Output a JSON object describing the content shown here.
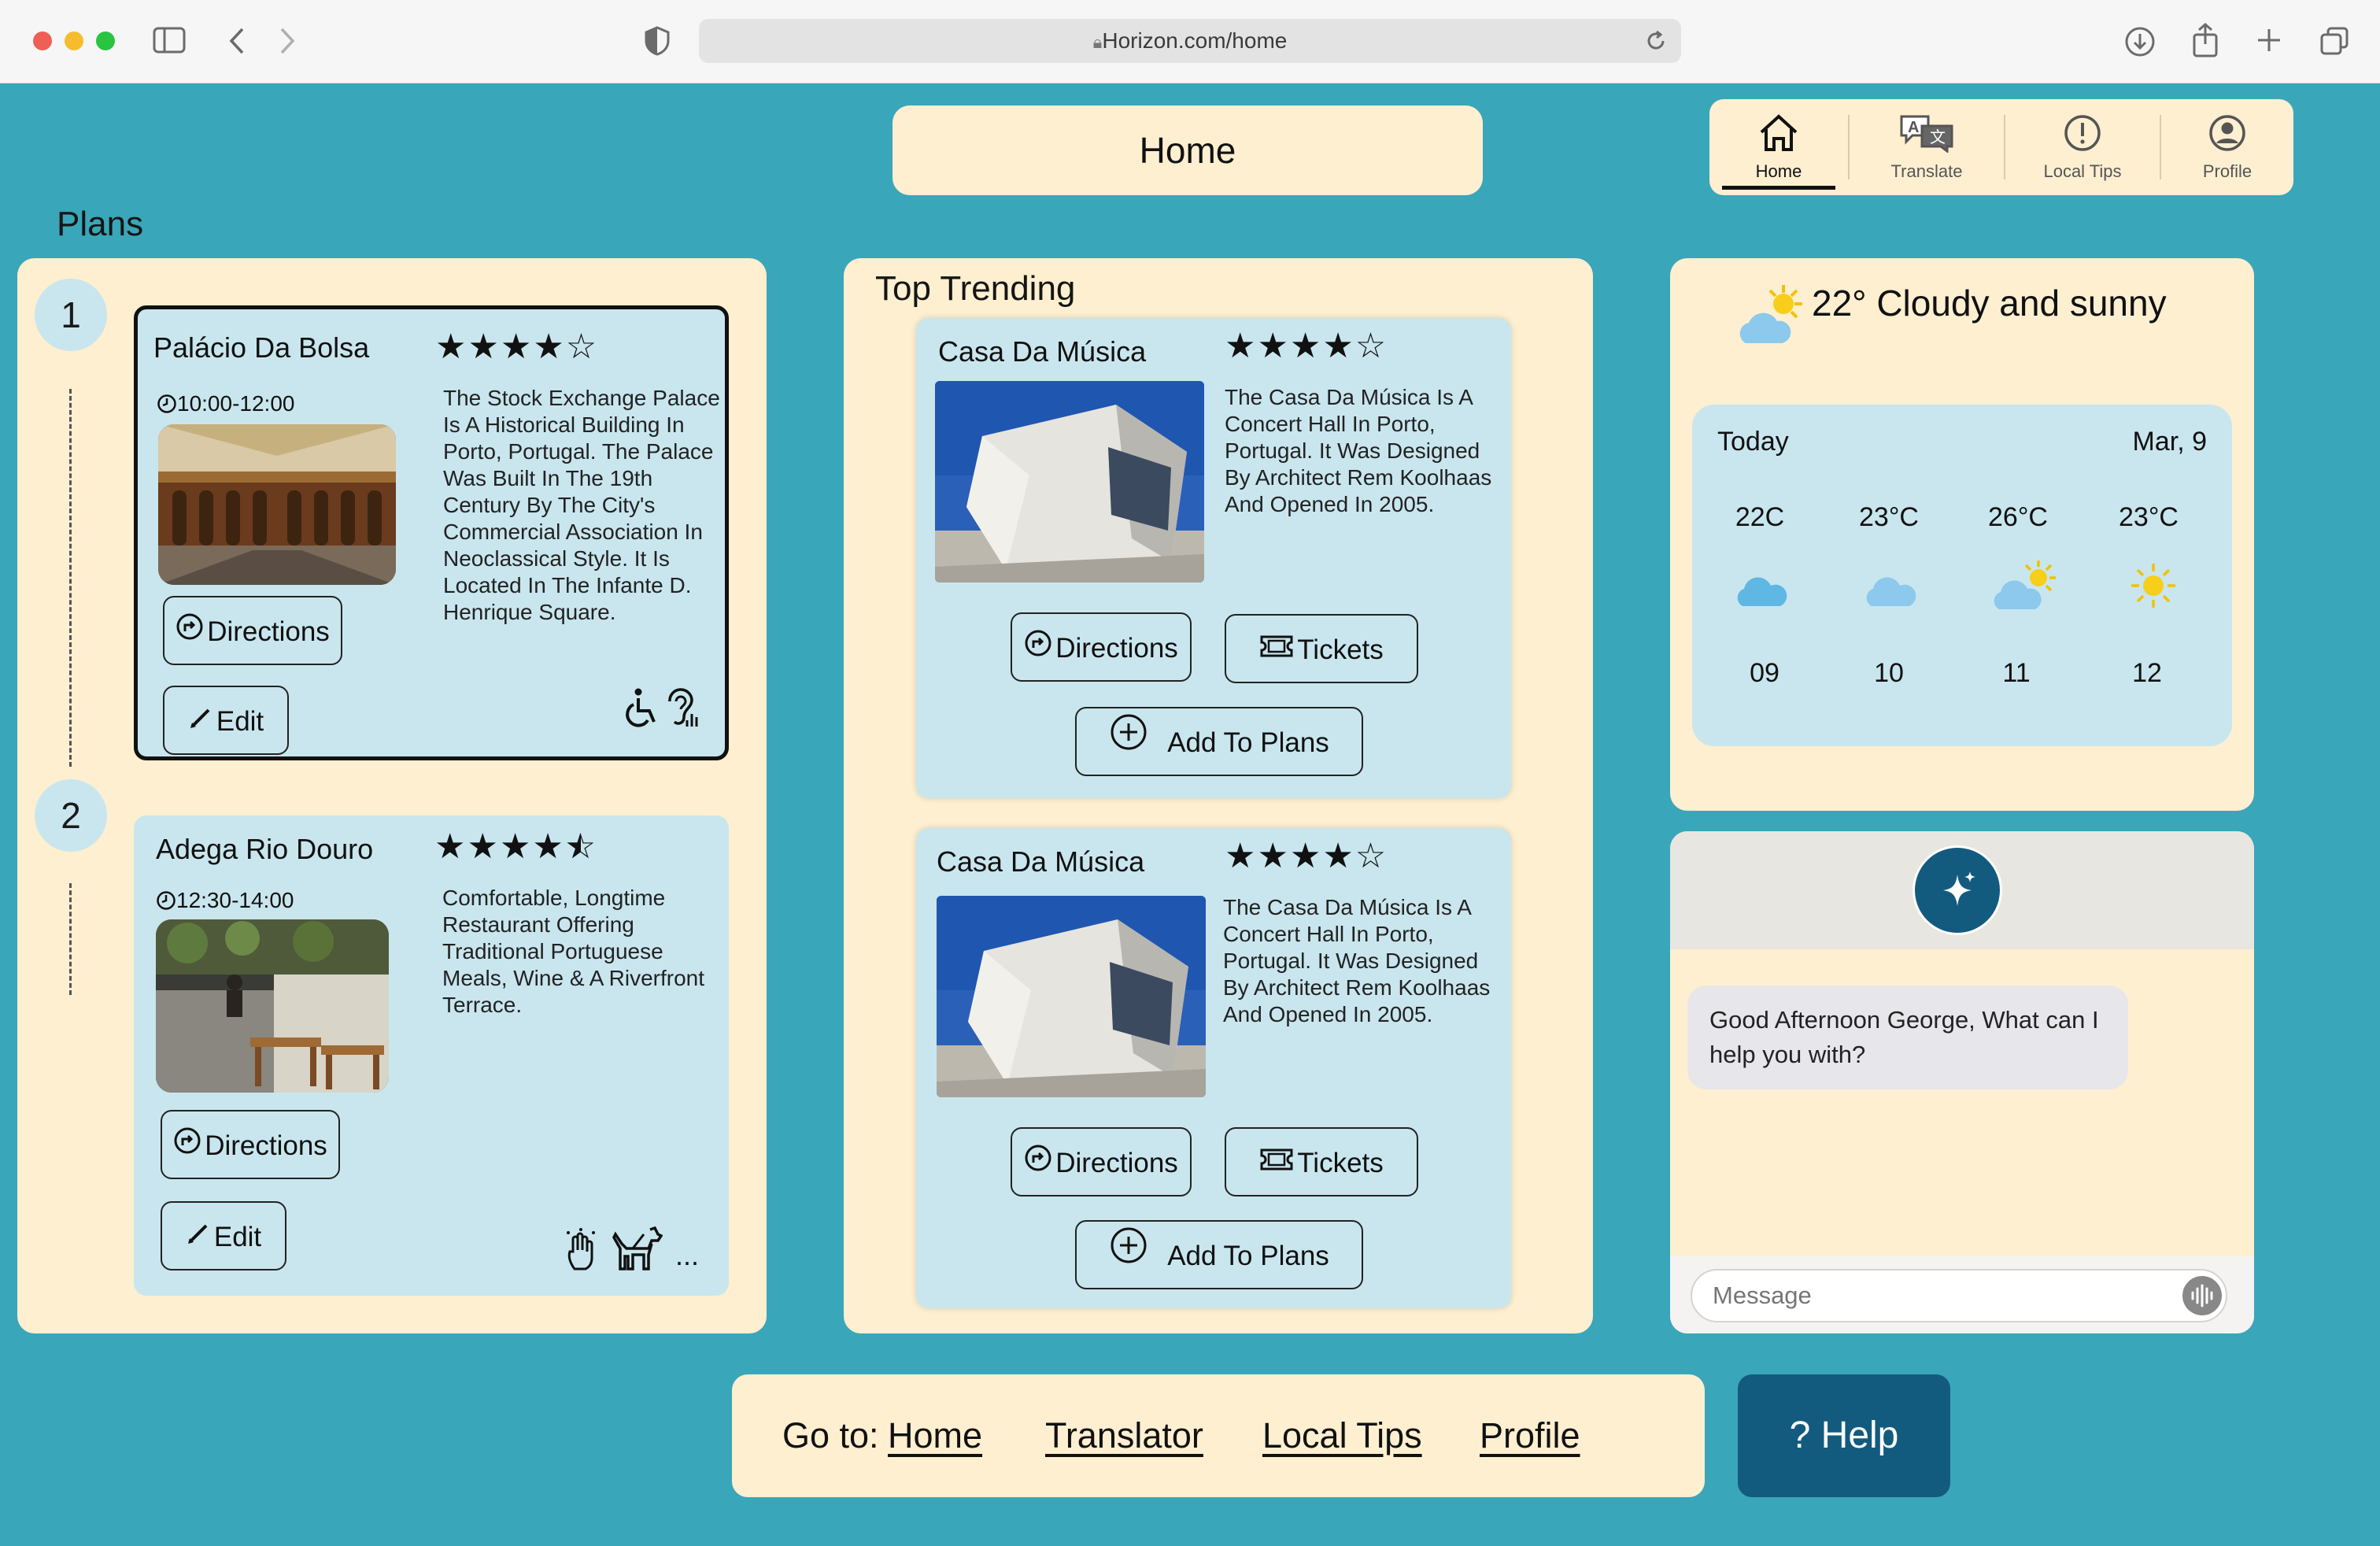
{
  "browser": {
    "url": "Horizon.com/home"
  },
  "page_title": "Home",
  "nav": {
    "items": [
      {
        "label": "Home",
        "icon": "home-icon",
        "active": true
      },
      {
        "label": "Translate",
        "icon": "translate-icon",
        "active": false
      },
      {
        "label": "Local Tips",
        "icon": "alert-circle-icon",
        "active": false
      },
      {
        "label": "Profile",
        "icon": "profile-icon",
        "active": false
      }
    ]
  },
  "plans": {
    "heading": "Plans",
    "items": [
      {
        "number": "1",
        "name": "Palácio Da Bolsa",
        "rating": 4,
        "rating_text": "★★★★☆",
        "time": "10:00-12:00",
        "description": "The Stock Exchange Palace Is A Historical Building In Porto, Portugal. The Palace Was Built In The 19th Century By The City's Commercial Association In Neoclassical Style. It Is Located In The Infante D. Henrique Square.",
        "directions_label": "Directions",
        "edit_label": "Edit",
        "accessibility_icons": [
          "wheelchair-icon",
          "hearing-icon"
        ]
      },
      {
        "number": "2",
        "name": "Adega Rio Douro",
        "rating": 4.5,
        "rating_text": "★★★★",
        "time": "12:30-14:00",
        "description": "Comfortable, Longtime Restaurant Offering Traditional Portuguese Meals, Wine & A Riverfront Terrace.",
        "directions_label": "Directions",
        "edit_label": "Edit",
        "accessibility_icons": [
          "touch-icon",
          "service-dog-icon"
        ],
        "more_label": "..."
      }
    ]
  },
  "trending": {
    "heading": "Top Trending",
    "items": [
      {
        "name": "Casa Da Música",
        "rating": 4,
        "rating_text": "★★★★☆",
        "description": "The Casa Da Música Is A Concert Hall In Porto, Portugal. It Was Designed By Architect Rem Koolhaas And Opened In 2005.",
        "directions_label": "Directions",
        "tickets_label": "Tickets",
        "add_label": "Add To Plans"
      },
      {
        "name": "Casa Da Música",
        "rating": 4,
        "rating_text": "★★★★☆",
        "description": "The Casa Da Música Is A Concert Hall In Porto, Portugal. It Was Designed By Architect Rem Koolhaas And Opened In 2005.",
        "directions_label": "Directions",
        "tickets_label": "Tickets",
        "add_label": "Add To Plans"
      }
    ]
  },
  "weather": {
    "current": "22° Cloudy and sunny",
    "day_label": "Today",
    "date": "Mar, 9",
    "hours": [
      {
        "temp": "22C",
        "icon": "cloud-icon",
        "hour": "09"
      },
      {
        "temp": "23°C",
        "icon": "cloud-icon",
        "hour": "10"
      },
      {
        "temp": "26°C",
        "icon": "partly-sunny-icon",
        "hour": "11"
      },
      {
        "temp": "23°C",
        "icon": "sun-icon",
        "hour": "12"
      }
    ]
  },
  "chat": {
    "greeting": "Good Afternoon George, What can I help you with?",
    "placeholder": "Message"
  },
  "footer": {
    "prefix": "Go to:",
    "links": [
      "Home",
      "Translator",
      "Local Tips",
      "Profile"
    ],
    "help_label": "? Help"
  },
  "colors": {
    "background": "#3aa6b9",
    "panel": "#fdefd0",
    "card": "#c9e6ee",
    "accent": "#135b7e"
  }
}
